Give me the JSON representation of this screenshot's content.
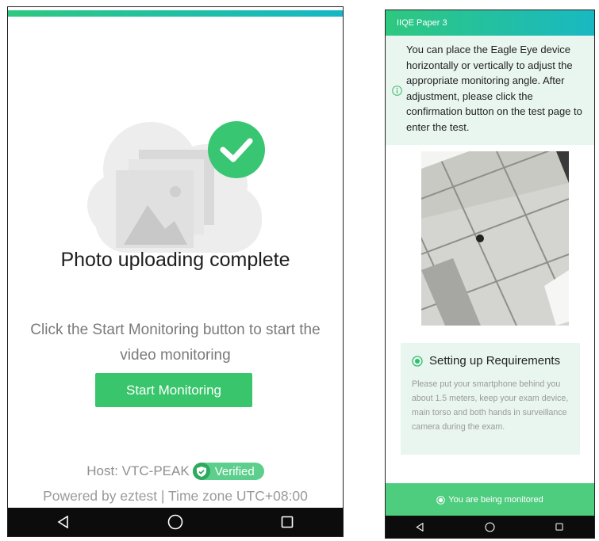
{
  "left_screen": {
    "title": "Photo uploading complete",
    "instruction": "Click the Start Monitoring button to start the video monitoring",
    "start_button_label": "Start Monitoring",
    "host_text": "Host: VTC-PEAK",
    "verified_badge": "Verified",
    "footer": "Powered by eztest | Time zone UTC+08:00",
    "colors": {
      "accent_green": "#38c56b",
      "gradient_start": "#2ec87f",
      "gradient_end": "#16b7c6"
    }
  },
  "right_screen": {
    "header_title": "IIQE Paper 3",
    "notice": "You can place the Eagle Eye device horizontally or vertically to adjust the appropriate monitoring angle. After adjustment, please click the confirmation button on the test page to enter the test.",
    "requirements_title": "Setting up Requirements",
    "requirements_text": "Please put your smartphone behind you about 1.5 meters, keep your exam device, main torso and both hands in surveillance camera during the exam.",
    "monitor_status": "You are being monitored",
    "colors": {
      "notice_bg": "#e9f6ef",
      "status_bar": "#4fcd7f"
    }
  },
  "nav_icons": [
    "back-icon",
    "home-icon",
    "recents-icon"
  ]
}
